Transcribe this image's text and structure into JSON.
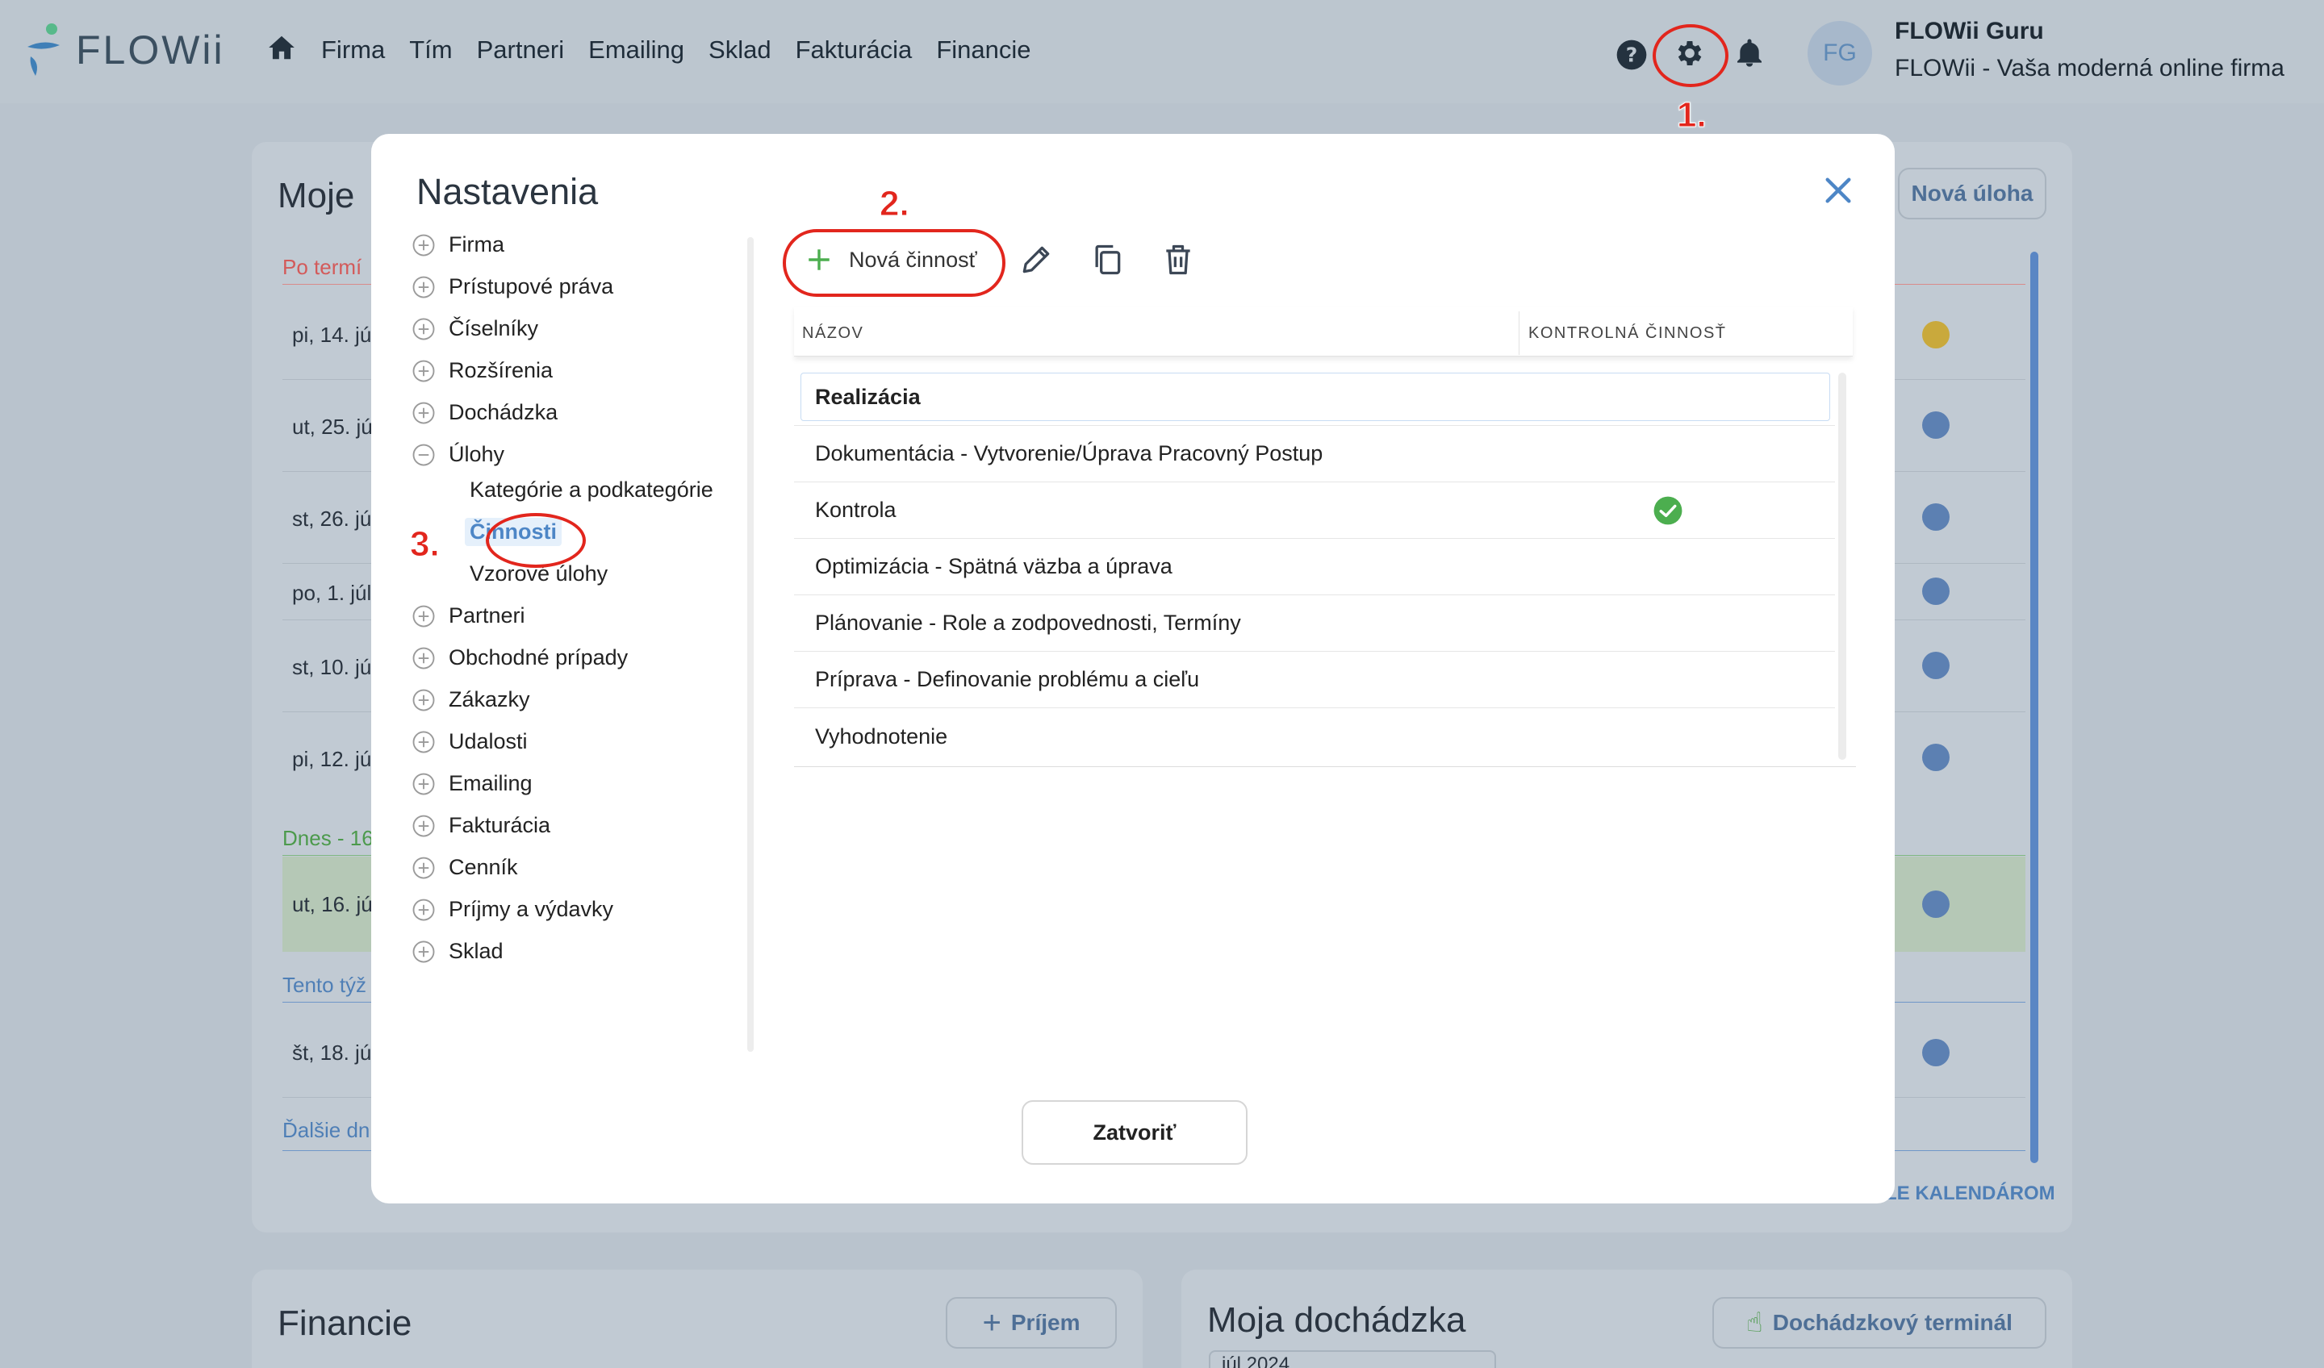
{
  "app": {
    "logo_text": "FLOWii",
    "nav": [
      "Firma",
      "Tím",
      "Partneri",
      "Emailing",
      "Sklad",
      "Fakturácia",
      "Financie"
    ],
    "user": {
      "initials": "FG",
      "name": "FLOWii Guru",
      "company": "FLOWii - Vaša moderná online firma"
    }
  },
  "annotations": {
    "n1": "1.",
    "n2": "2.",
    "n3": "3.",
    "color": "#e2261d"
  },
  "background": {
    "tasks_title": "Moje",
    "new_task_btn": "Nová úloha",
    "sections": {
      "overdue": "Po termí",
      "today": "Dnes - 16",
      "this_week": "Tento týž",
      "next": "Ďalšie dn"
    },
    "dates": [
      "pi, 14. jú",
      "ut, 25. jú",
      "st, 26. jú",
      "po, 1. júl",
      "st, 10. jú",
      "pi, 12. jú",
      "ut, 16. jú",
      "št, 18. jú"
    ],
    "calendar_link": "LE KALENDÁROM",
    "finance_title": "Financie",
    "income_btn": "Príjem",
    "attendance_title": "Moja dochádzka",
    "attendance_btn": "Dochádzkový terminál",
    "month_value": "júl 2024"
  },
  "modal": {
    "title": "Nastavenia",
    "tree": {
      "firma": "Firma",
      "pristupove": "Prístupové práva",
      "ciselniky": "Číselníky",
      "rozsirenia": "Rozšírenia",
      "dochadzka": "Dochádzka",
      "ulohy": "Úlohy",
      "ulohy_sub": {
        "kategorie": "Kategórie a podkategórie",
        "cinnosti": "Činnosti",
        "vzorove": "Vzorové úlohy"
      },
      "partneri": "Partneri",
      "obchodne": "Obchodné prípady",
      "zakazky": "Zákazky",
      "udalosti": "Udalosti",
      "emailing": "Emailing",
      "fakturacia": "Fakturácia",
      "cennik": "Cenník",
      "prijmy": "Príjmy a výdavky",
      "sklad": "Sklad"
    },
    "toolbar": {
      "new_label": "Nová činnosť"
    },
    "table": {
      "col_name": "NÁZOV",
      "col_control": "KONTROLNÁ ČINNOSŤ",
      "rows": [
        "Realizácia",
        "Dokumentácia - Vytvorenie/Úprava Pracovný Postup",
        "Kontrola",
        "Optimizácia - Spätná väzba a úprava",
        "Plánovanie - Role a zodpovednosti, Termíny",
        "Príprava - Definovanie problému a cieľu",
        "Vyhodnotenie"
      ],
      "control_flags": [
        false,
        false,
        true,
        false,
        false,
        false,
        false
      ]
    },
    "close_label": "Zatvoriť"
  }
}
